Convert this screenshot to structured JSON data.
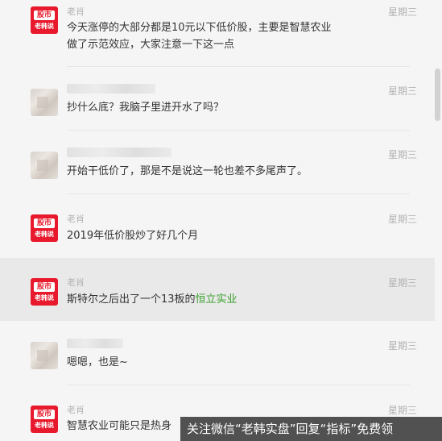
{
  "comments": [
    {
      "author": "老肖",
      "time": "星期三",
      "text_line1": "今天涨停的大部分都是10元以下低价股，主要是智慧农业",
      "text_line2": "做了示范效应，大家注意一下这一点"
    },
    {
      "author": "",
      "time": "星期三",
      "text": "抄什么底？我脑子里进开水了吗？"
    },
    {
      "author": "",
      "time": "星期三",
      "text": "开始干低价了，那是不是说这一轮也差不多尾声了。"
    },
    {
      "author": "老肖",
      "time": "星期三",
      "text": "2019年低价股炒了好几个月"
    },
    {
      "author": "老肖",
      "time": "星期三",
      "text_prefix": "斯特尔之后出了一个13板的",
      "text_link": "恒立实业"
    },
    {
      "author": "",
      "time": "星期三",
      "text": "嗯嗯，也是~"
    },
    {
      "author": "老肖",
      "time": "星期三",
      "text": "智慧农业可能只是热身"
    }
  ],
  "logo": {
    "line1": "股市",
    "line2": "老韩说"
  },
  "watermark": "关注微信“老韩实盘”回复“指标”免费领",
  "colors": {
    "accent_red": "#e8192c",
    "link_green": "#3aa02d"
  }
}
